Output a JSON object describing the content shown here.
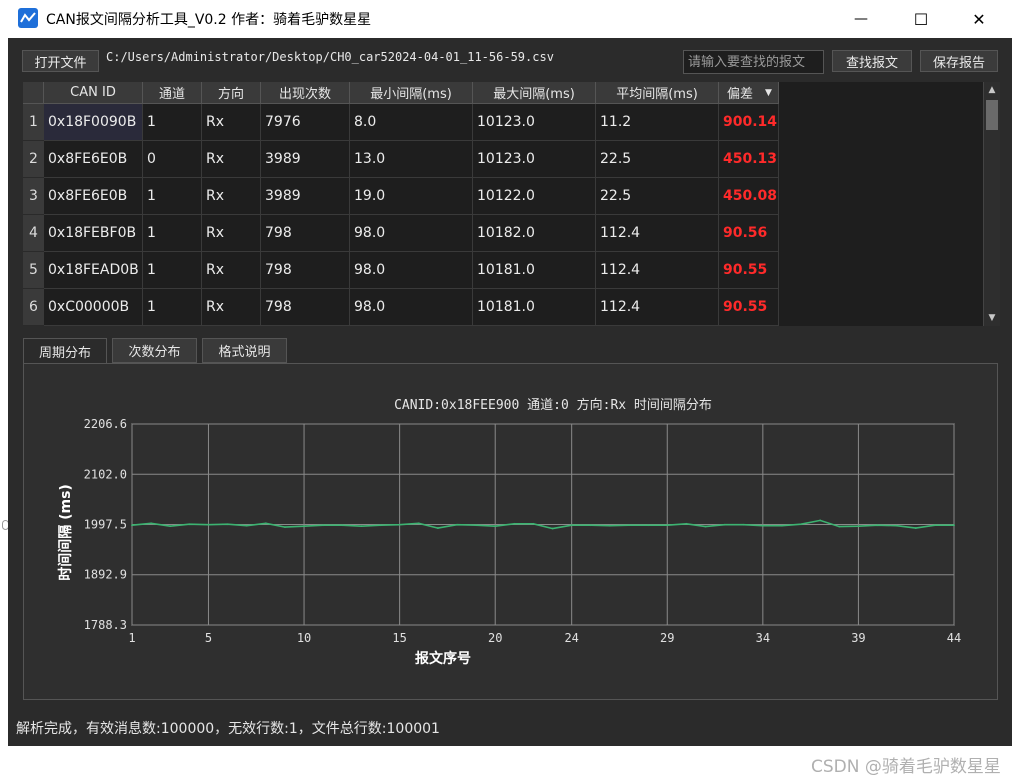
{
  "window": {
    "title": "CAN报文间隔分析工具_V0.2 作者：骑着毛驴数星星",
    "minimize_glyph": "—",
    "maximize_glyph": "☐",
    "close_glyph": "✕"
  },
  "toolbar": {
    "open_label": "打开文件",
    "file_path": "C:/Users/Administrator/Desktop/CH0_car52024-04-01_11-56-59.csv",
    "search_placeholder": "请输入要查找的报文",
    "find_label": "查找报文",
    "save_label": "保存报告"
  },
  "table": {
    "columns": [
      "CAN ID",
      "通道",
      "方向",
      "出现次数",
      "最小间隔(ms)",
      "最大间隔(ms)",
      "平均间隔(ms)",
      "偏差"
    ],
    "sort_indicator": "▼",
    "rows": [
      {
        "num": "1",
        "cells": [
          "0x18F0090B",
          "1",
          "Rx",
          "7976",
          "8.0",
          "10123.0",
          "11.2",
          "900.14"
        ]
      },
      {
        "num": "2",
        "cells": [
          "0x8FE6E0B",
          "0",
          "Rx",
          "3989",
          "13.0",
          "10123.0",
          "22.5",
          "450.13"
        ]
      },
      {
        "num": "3",
        "cells": [
          "0x8FE6E0B",
          "1",
          "Rx",
          "3989",
          "19.0",
          "10122.0",
          "22.5",
          "450.08"
        ]
      },
      {
        "num": "4",
        "cells": [
          "0x18FEBF0B",
          "1",
          "Rx",
          "798",
          "98.0",
          "10182.0",
          "112.4",
          "90.56"
        ]
      },
      {
        "num": "5",
        "cells": [
          "0x18FEAD0B",
          "1",
          "Rx",
          "798",
          "98.0",
          "10181.0",
          "112.4",
          "90.55"
        ]
      },
      {
        "num": "6",
        "cells": [
          "0xC00000B",
          "1",
          "Rx",
          "798",
          "98.0",
          "10181.0",
          "112.4",
          "90.55"
        ]
      }
    ],
    "deviation_color": "#ff2a2a"
  },
  "tabs": [
    {
      "label": "周期分布",
      "active": true
    },
    {
      "label": "次数分布",
      "active": false
    },
    {
      "label": "格式说明",
      "active": false
    }
  ],
  "chart_data": {
    "type": "line",
    "title": "CANID:0x18FEE900 通道:0 方向:Rx 时间间隔分布",
    "xlabel": "报文序号",
    "ylabel": "时间间隔 (ms)",
    "xlim": [
      1,
      44
    ],
    "ylim": [
      1788.3,
      2206.6
    ],
    "xticks": [
      "1",
      "5",
      "10",
      "15",
      "20",
      "24",
      "29",
      "34",
      "39",
      "44"
    ],
    "yticks": [
      "1788.3",
      "1892.9",
      "1997.5",
      "2102.0",
      "2206.6"
    ],
    "grid": true,
    "line_color": "#3cb371",
    "series": [
      {
        "x": [
          1,
          2,
          3,
          4,
          5,
          6,
          7,
          8,
          9,
          10,
          11,
          12,
          13,
          14,
          15,
          16,
          17,
          18,
          19,
          20,
          21,
          22,
          23,
          24,
          25,
          26,
          27,
          28,
          29,
          30,
          31,
          32,
          33,
          34,
          35,
          36,
          37,
          38,
          39,
          40,
          41,
          42,
          43,
          44
        ],
        "values": [
          1996,
          2000,
          1994,
          1998,
          1997,
          1998,
          1995,
          2000,
          1992,
          1994,
          1996,
          1996,
          1994,
          1996,
          1997,
          2000,
          1990,
          1997,
          1996,
          1994,
          1999,
          1999,
          1989,
          1996,
          1996,
          1995,
          1996,
          1996,
          1996,
          1999,
          1993,
          1997,
          1997,
          1995,
          1995,
          1998,
          2006,
          1993,
          1994,
          1996,
          1995,
          1990,
          1996,
          1996
        ]
      }
    ]
  },
  "status": {
    "text": "解析完成，有效消息数:100000，无效行数:1，文件总行数:100001"
  },
  "watermark": "CSDN @骑着毛驴数星星"
}
